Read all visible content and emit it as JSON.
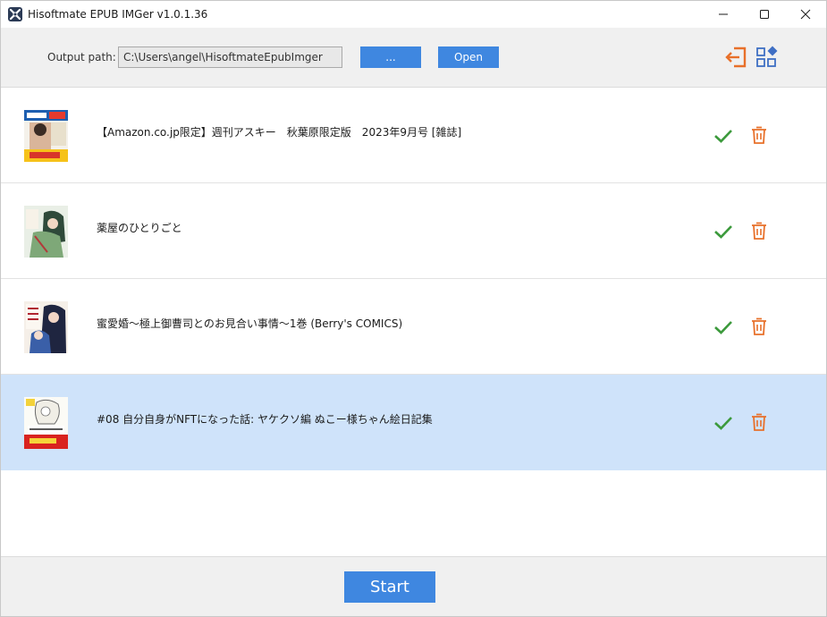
{
  "window": {
    "title": "Hisoftmate EPUB IMGer v1.0.1.36"
  },
  "toolbar": {
    "output_label": "Output path:",
    "output_path": "C:\\Users\\angel\\HisoftmateEpubImger",
    "browse_label": "...",
    "open_label": "Open",
    "right_icons": [
      "exit-icon",
      "grid-layout-icon"
    ]
  },
  "books": [
    {
      "title": "【Amazon.co.jp限定】週刊アスキー　秋葉原限定版　2023年9月号 [雑誌]",
      "status_icon": "check-icon",
      "selected": false
    },
    {
      "title": "薬屋のひとりごと",
      "status_icon": "check-icon",
      "selected": false
    },
    {
      "title": "蜜愛婚～極上御曹司とのお見合い事情～1巻 (Berry's COMICS)",
      "status_icon": "check-icon",
      "selected": false
    },
    {
      "title": "#08 自分自身がNFTになった話: ヤケクソ編 ぬこー様ちゃん絵日記集",
      "status_icon": "check-icon",
      "selected": true
    }
  ],
  "footer": {
    "start_label": "Start"
  },
  "colors": {
    "accent_blue": "#3f87e0",
    "check_green": "#3c9a3c",
    "delete_orange": "#e8702a",
    "selected_row": "#cfe3fa",
    "panel_gray": "#f0f0f0"
  }
}
